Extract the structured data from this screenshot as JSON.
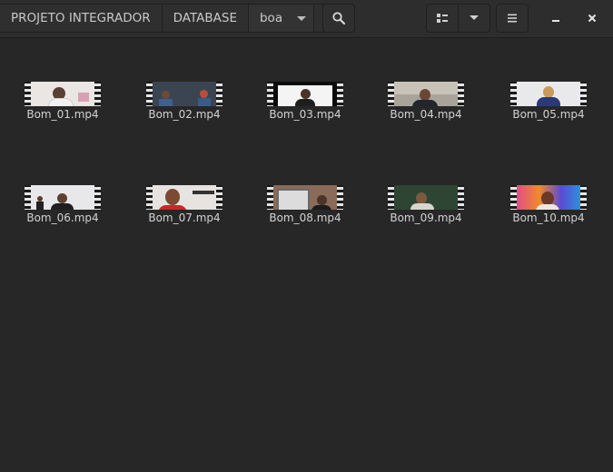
{
  "header": {
    "breadcrumbs": [
      "PROJETO INTEGRADOR",
      "DATABASE",
      "boa"
    ],
    "icons": {
      "search": "search-icon",
      "view": "grid-view-icon",
      "view_options": "chevron-down-icon",
      "menu": "hamburger-menu-icon",
      "minimize": "minimize-icon",
      "close": "close-icon"
    }
  },
  "files": [
    {
      "name": "Bom_01.mp4"
    },
    {
      "name": "Bom_02.mp4"
    },
    {
      "name": "Bom_03.mp4"
    },
    {
      "name": "Bom_04.mp4"
    },
    {
      "name": "Bom_05.mp4"
    },
    {
      "name": "Bom_06.mp4"
    },
    {
      "name": "Bom_07.mp4"
    },
    {
      "name": "Bom_08.mp4"
    },
    {
      "name": "Bom_09.mp4"
    },
    {
      "name": "Bom_10.mp4"
    }
  ]
}
